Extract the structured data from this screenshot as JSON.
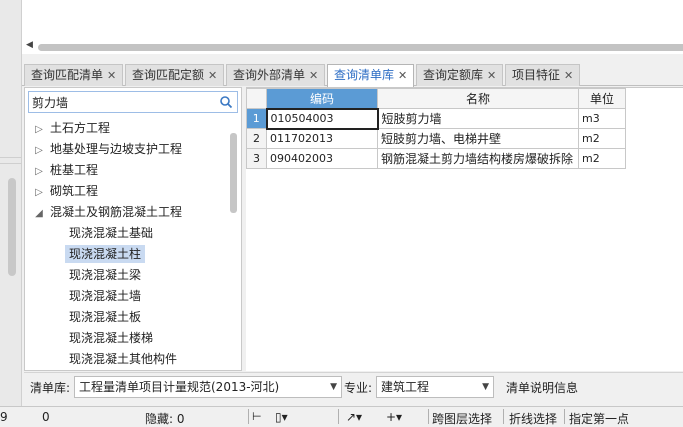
{
  "tabs": [
    {
      "label": "查询匹配清单",
      "close": "✕"
    },
    {
      "label": "查询匹配定额",
      "close": "✕"
    },
    {
      "label": "查询外部清单",
      "close": "✕"
    },
    {
      "label": "查询清单库",
      "close": "✕"
    },
    {
      "label": "查询定额库",
      "close": "✕"
    },
    {
      "label": "项目特征",
      "close": "✕"
    }
  ],
  "search": {
    "value": "剪力墙"
  },
  "tree": [
    {
      "label": "土石方工程",
      "arrow": "▷"
    },
    {
      "label": "地基处理与边坡支护工程",
      "arrow": "▷"
    },
    {
      "label": "桩基工程",
      "arrow": "▷"
    },
    {
      "label": "砌筑工程",
      "arrow": "▷"
    },
    {
      "label": "混凝土及钢筋混凝土工程",
      "arrow": "◢"
    },
    {
      "label": "现浇混凝土基础"
    },
    {
      "label": "现浇混凝土柱"
    },
    {
      "label": "现浇混凝土梁"
    },
    {
      "label": "现浇混凝土墙"
    },
    {
      "label": "现浇混凝土板"
    },
    {
      "label": "现浇混凝土楼梯"
    },
    {
      "label": "现浇混凝土其他构件"
    }
  ],
  "grid": {
    "headers": [
      "编码",
      "名称",
      "单位"
    ],
    "rows": [
      {
        "num": "1",
        "code": "010504003",
        "name": "短肢剪力墙",
        "unit": "m3"
      },
      {
        "num": "2",
        "code": "011702013",
        "name": "短肢剪力墙、电梯井壁",
        "unit": "m2"
      },
      {
        "num": "3",
        "code": "090402003",
        "name": "钢筋混凝土剪力墙结构楼房爆破拆除",
        "unit": "m2"
      }
    ]
  },
  "bottom": {
    "lib_label": "清单库:",
    "lib_value": "工程量清单项目计量规范(2013-河北)",
    "spec_label": "专业:",
    "spec_value": "建筑工程",
    "info_label": "清单说明信息"
  },
  "status": {
    "left_num1": "9",
    "left_num2": "0",
    "hidden": "隐藏: 0",
    "pick_layer": "跨图层选择",
    "line_select": "折线选择",
    "specify_point": "指定第一点"
  }
}
